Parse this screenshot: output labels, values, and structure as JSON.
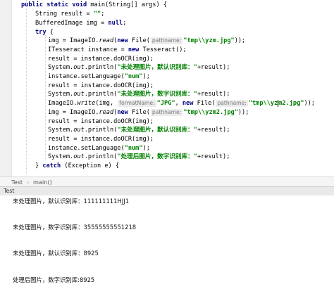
{
  "code": {
    "l1": {
      "kw": "public static void",
      "rest": " main(String[] args) {"
    },
    "l2": {
      "pre": "String result = ",
      "str": "\"\"",
      "post": ";"
    },
    "l3": {
      "pre": "BufferedImage img = ",
      "kw": "null",
      "post": ";"
    },
    "l4": {
      "kw": "try",
      "post": " {"
    },
    "l5": {
      "pre": "img = ImageIO.",
      "it": "read",
      "paren": "(",
      "kw": "new",
      "mid": " File(",
      "hint": "pathname:",
      "str": "\"tmp\\\\yzm.jpg\"",
      "post": "));"
    },
    "l6": {
      "pre": "ITesseract instance = ",
      "kw": "new",
      "post": " Tesseract();"
    },
    "l7": {
      "text": "result = instance.doOCR(img);"
    },
    "l8": {
      "pre": "System.",
      "it": "out",
      "mid": ".println(",
      "str": "\"未处理图片，默认识别库：\"",
      "post": "+result);"
    },
    "l9": {
      "pre": "instance.setLanguage(",
      "str": "\"num\"",
      "post": ");"
    },
    "l10": {
      "text": "result = instance.doOCR(img);"
    },
    "l11": {
      "pre": "System.",
      "it": "out",
      "mid": ".println(",
      "str": "\"未处理图片，数字识别库：\"",
      "post": "+result);"
    },
    "l12": {
      "pre": "ImageIO.",
      "it": "write",
      "mid": "(img, ",
      "hint1": "formatName:",
      "str1": "\"JPG\"",
      "comma": ", ",
      "kw": "new",
      "file": " File(",
      "hint2": "pathname:",
      "str2a": "\"tmp\\\\yz",
      "str2b": "m2.jpg\"",
      "post": "));"
    },
    "l13": {
      "pre": "img = ImageIO.",
      "it": "read",
      "paren": "(",
      "kw": "new",
      "mid": " File(",
      "hint": "pathname:",
      "str": "\"tmp\\\\yzm2.jpg\"",
      "post": "));"
    },
    "l14": {
      "text": "result = instance.doOCR(img);"
    },
    "l15": {
      "pre": "System.",
      "it": "out",
      "mid": ".println(",
      "str": "\"未处理图片，默认识别库：\"",
      "post": "+result);"
    },
    "l16": {
      "text": "result = instance.doOCR(img);"
    },
    "l17": {
      "pre": "instance.setLanguage(",
      "str": "\"num\"",
      "post": ");"
    },
    "l18": {
      "pre": "System.",
      "it": "out",
      "mid": ".println(",
      "str": "\"处理后图片，数字识别库：\"",
      "post": "+result);"
    },
    "l19": {
      "pre": "} ",
      "kw": "catch",
      "post": " (Exception e) {"
    }
  },
  "breadcrumb": {
    "class_name": "Test",
    "sep": "›",
    "method": "main()"
  },
  "run_tab": {
    "label": "Test"
  },
  "console_lines": [
    "未处理图片，默认识别库：111111111HJJ1",
    "未处理图片，数字识别库：35555555551218",
    "未处理图片，默认识别库：8925",
    "处理后图片，数字识别库:8925"
  ]
}
